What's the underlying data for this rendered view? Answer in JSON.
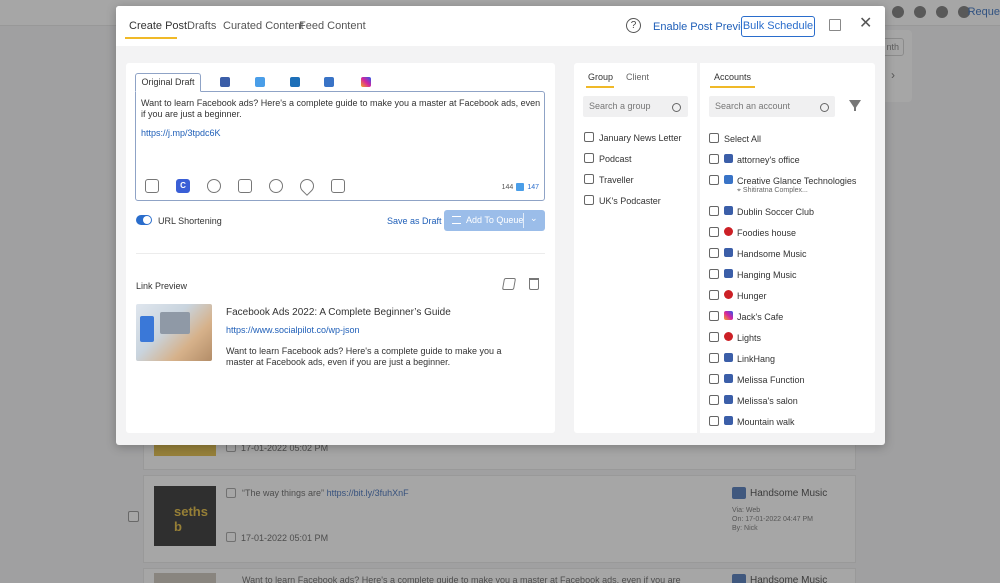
{
  "background": {
    "topbar_request": "Reque",
    "month_btn": "nth",
    "rows": [
      {
        "date": "17-01-2022 05:02 PM"
      },
      {
        "title": "“The way things are”",
        "link": "https://bit.ly/3fuhXnF",
        "thumb_text": "seths b",
        "date": "17-01-2022 05:01 PM",
        "account": "Handsome Music",
        "via": "Via: Web",
        "on": "On: 17-01-2022 04:47 PM",
        "by": "By: Nick"
      },
      {
        "text": "Want to learn Facebook ads? Here's a complete guide to make you a master at Facebook ads, even if you are",
        "account": "Handsome Music"
      }
    ]
  },
  "header": {
    "tabs": [
      {
        "label": "Create Post"
      },
      {
        "label": "Drafts"
      },
      {
        "label": "Curated Content"
      },
      {
        "label": "Feed Content"
      }
    ],
    "help": "?",
    "enable_previews": "Enable Post Previews",
    "bulk_schedule": "Bulk Schedule",
    "close": "✕"
  },
  "compose": {
    "original_draft_tab": "Original Draft",
    "networks": [
      "facebook-icon",
      "twitter-icon",
      "linkedin-icon",
      "google-business-icon",
      "instagram-icon"
    ],
    "text": "Want to learn Facebook ads? Here's a complete guide to make you a master at Facebook ads, even if you are just a beginner.",
    "link": "https://j.mp/3tpdc6K",
    "tools": [
      "media-library-icon",
      "canva-icon",
      "emoji-icon",
      "gif-icon",
      "target-icon",
      "location-icon",
      "image-upload-icon"
    ],
    "canva_letter": "C",
    "count_general": "144",
    "count_twitter": "147",
    "url_shortening": "URL Shortening",
    "save_as_draft": "Save as Draft",
    "add_to_queue": "Add To Queue",
    "dropdown": "⌄"
  },
  "link_preview": {
    "title": "Link Preview",
    "headline": "Facebook Ads 2022: A Complete Beginner’s Guide",
    "url": "https://www.socialpilot.co/wp-json",
    "description": "Want to learn Facebook ads? Here's a complete guide to make you a master at Facebook ads, even if you are just a beginner."
  },
  "groups": {
    "tab_group": "Group",
    "tab_client": "Client",
    "search_placeholder": "Search a group",
    "items": [
      "January News Letter",
      "Podcast",
      "Traveller",
      "UK's Podcaster"
    ]
  },
  "accounts": {
    "tab": "Accounts",
    "search_placeholder": "Search an account",
    "select_all": "Select All",
    "items": [
      {
        "name": "attorney's office",
        "network": "facebook"
      },
      {
        "name": "Creative Glance Technologies",
        "network": "google-business",
        "sub": "Shitiratna Complex..."
      },
      {
        "name": "Dublin Soccer Club",
        "network": "facebook"
      },
      {
        "name": "Foodies house",
        "network": "pinterest"
      },
      {
        "name": "Handsome Music",
        "network": "facebook-group"
      },
      {
        "name": "Hanging Music",
        "network": "facebook"
      },
      {
        "name": "Hunger",
        "network": "pinterest"
      },
      {
        "name": "Jack's Cafe",
        "network": "instagram"
      },
      {
        "name": "Lights",
        "network": "pinterest"
      },
      {
        "name": "LinkHang",
        "network": "facebook-group"
      },
      {
        "name": "Melissa Function",
        "network": "facebook-group"
      },
      {
        "name": "Melissa's salon",
        "network": "facebook"
      },
      {
        "name": "Mountain walk",
        "network": "facebook"
      }
    ]
  },
  "colors": {
    "accent": "#f0b928",
    "primary": "#2a6dcc",
    "link": "#1f5fb8"
  }
}
